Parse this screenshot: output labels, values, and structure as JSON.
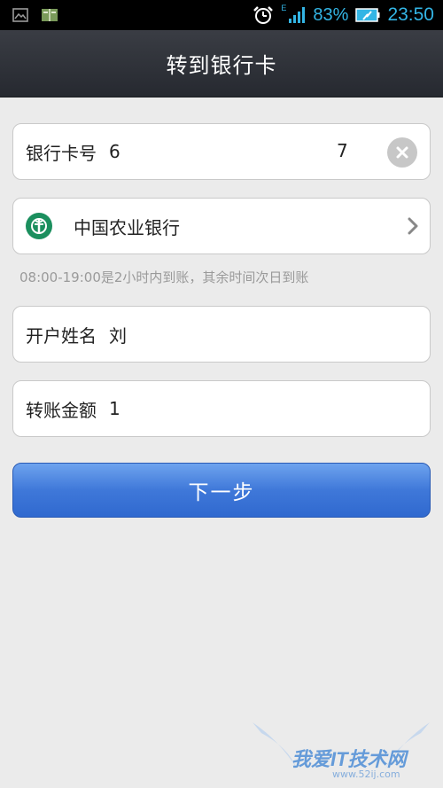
{
  "status_bar": {
    "network_type": "E",
    "battery_percent": "83%",
    "time": "23:50",
    "accent_color": "#33b5e5"
  },
  "header": {
    "title": "转到银行卡"
  },
  "card_field": {
    "label": "银行卡号",
    "value_start": "6",
    "value_end": "7"
  },
  "bank_field": {
    "bank_name": "中国农业银行",
    "logo_icon": "abc-bank-logo-icon"
  },
  "notice": "08:00-19:00是2小时内到账，其余时间次日到账",
  "name_field": {
    "label": "开户姓名",
    "value": "刘"
  },
  "amount_field": {
    "label": "转账金额",
    "value": "1"
  },
  "next_button": {
    "label": "下一步",
    "color": "#3f78d9"
  },
  "watermark": {
    "text": "我爱IT技术网",
    "url": "www.52ij.com"
  }
}
